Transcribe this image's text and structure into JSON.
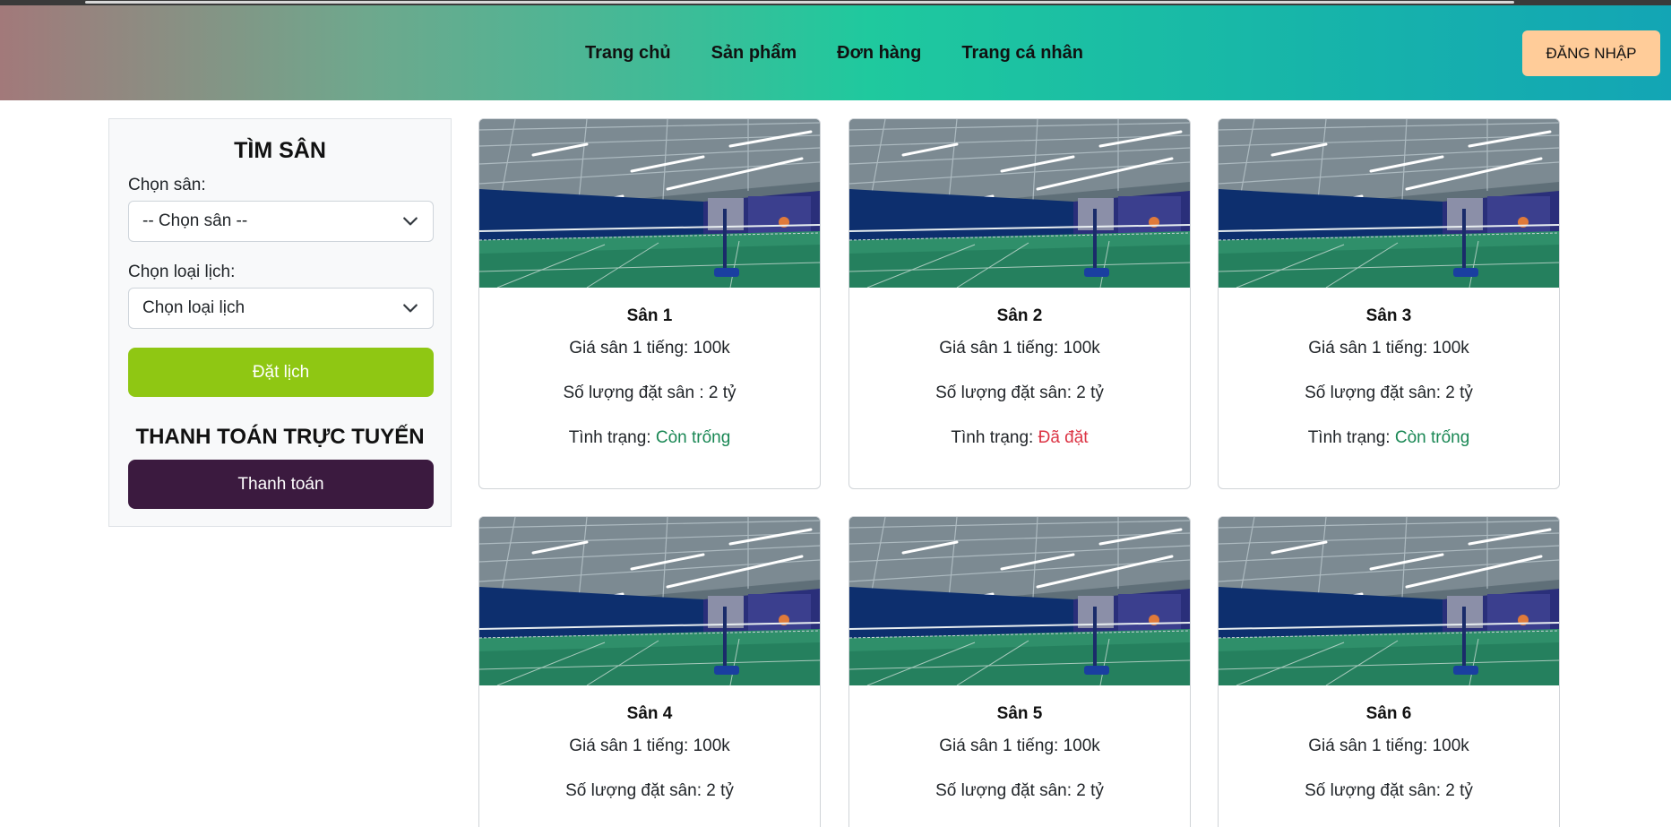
{
  "nav": {
    "items": [
      "Trang chủ",
      "Sản phẩm",
      "Đơn hàng",
      "Trang cá nhân"
    ],
    "login_label": "ĐĂNG NHẬP"
  },
  "sidebar": {
    "title": "TÌM SÂN",
    "court_label": "Chọn sân:",
    "court_select_value": "-- Chọn sân --",
    "schedule_label": "Chọn loại lịch:",
    "schedule_select_value": "Chọn loại lịch",
    "book_label": "Đặt lịch",
    "payment_title": "THANH TOÁN TRỰC TUYẾN",
    "payment_label": "Thanh toán"
  },
  "courts": [
    {
      "name": "Sân 1",
      "price": "Giá sân 1 tiếng: 100k",
      "qty": "Số lượng đặt sân : 2 tỷ",
      "status_label": "Tình trạng: ",
      "status": "Còn trống",
      "status_color": "#198754"
    },
    {
      "name": "Sân 2",
      "price": "Giá sân 1 tiếng: 100k",
      "qty": "Số lượng đặt sân: 2 tỷ",
      "status_label": "Tình trạng: ",
      "status": "Đã đặt",
      "status_color": "#dc3545"
    },
    {
      "name": "Sân 3",
      "price": "Giá sân 1 tiếng: 100k",
      "qty": "Số lượng đặt sân: 2 tỷ",
      "status_label": "Tình trạng: ",
      "status": "Còn trống",
      "status_color": "#198754"
    },
    {
      "name": "Sân 4",
      "price": "Giá sân 1 tiếng: 100k",
      "qty": "Số lượng đặt sân: 2 tỷ"
    },
    {
      "name": "Sân 5",
      "price": "Giá sân 1 tiếng: 100k",
      "qty": "Số lượng đặt sân: 2 tỷ"
    },
    {
      "name": "Sân 6",
      "price": "Giá sân 1 tiếng: 100k",
      "qty": "Số lượng đặt sân: 2 tỷ"
    }
  ],
  "colors": {
    "accent_green": "#8fc713",
    "pay_purple": "#3b1a3f",
    "login_peach": "#ffcc99",
    "status_free": "#198754",
    "status_booked": "#dc3545"
  }
}
